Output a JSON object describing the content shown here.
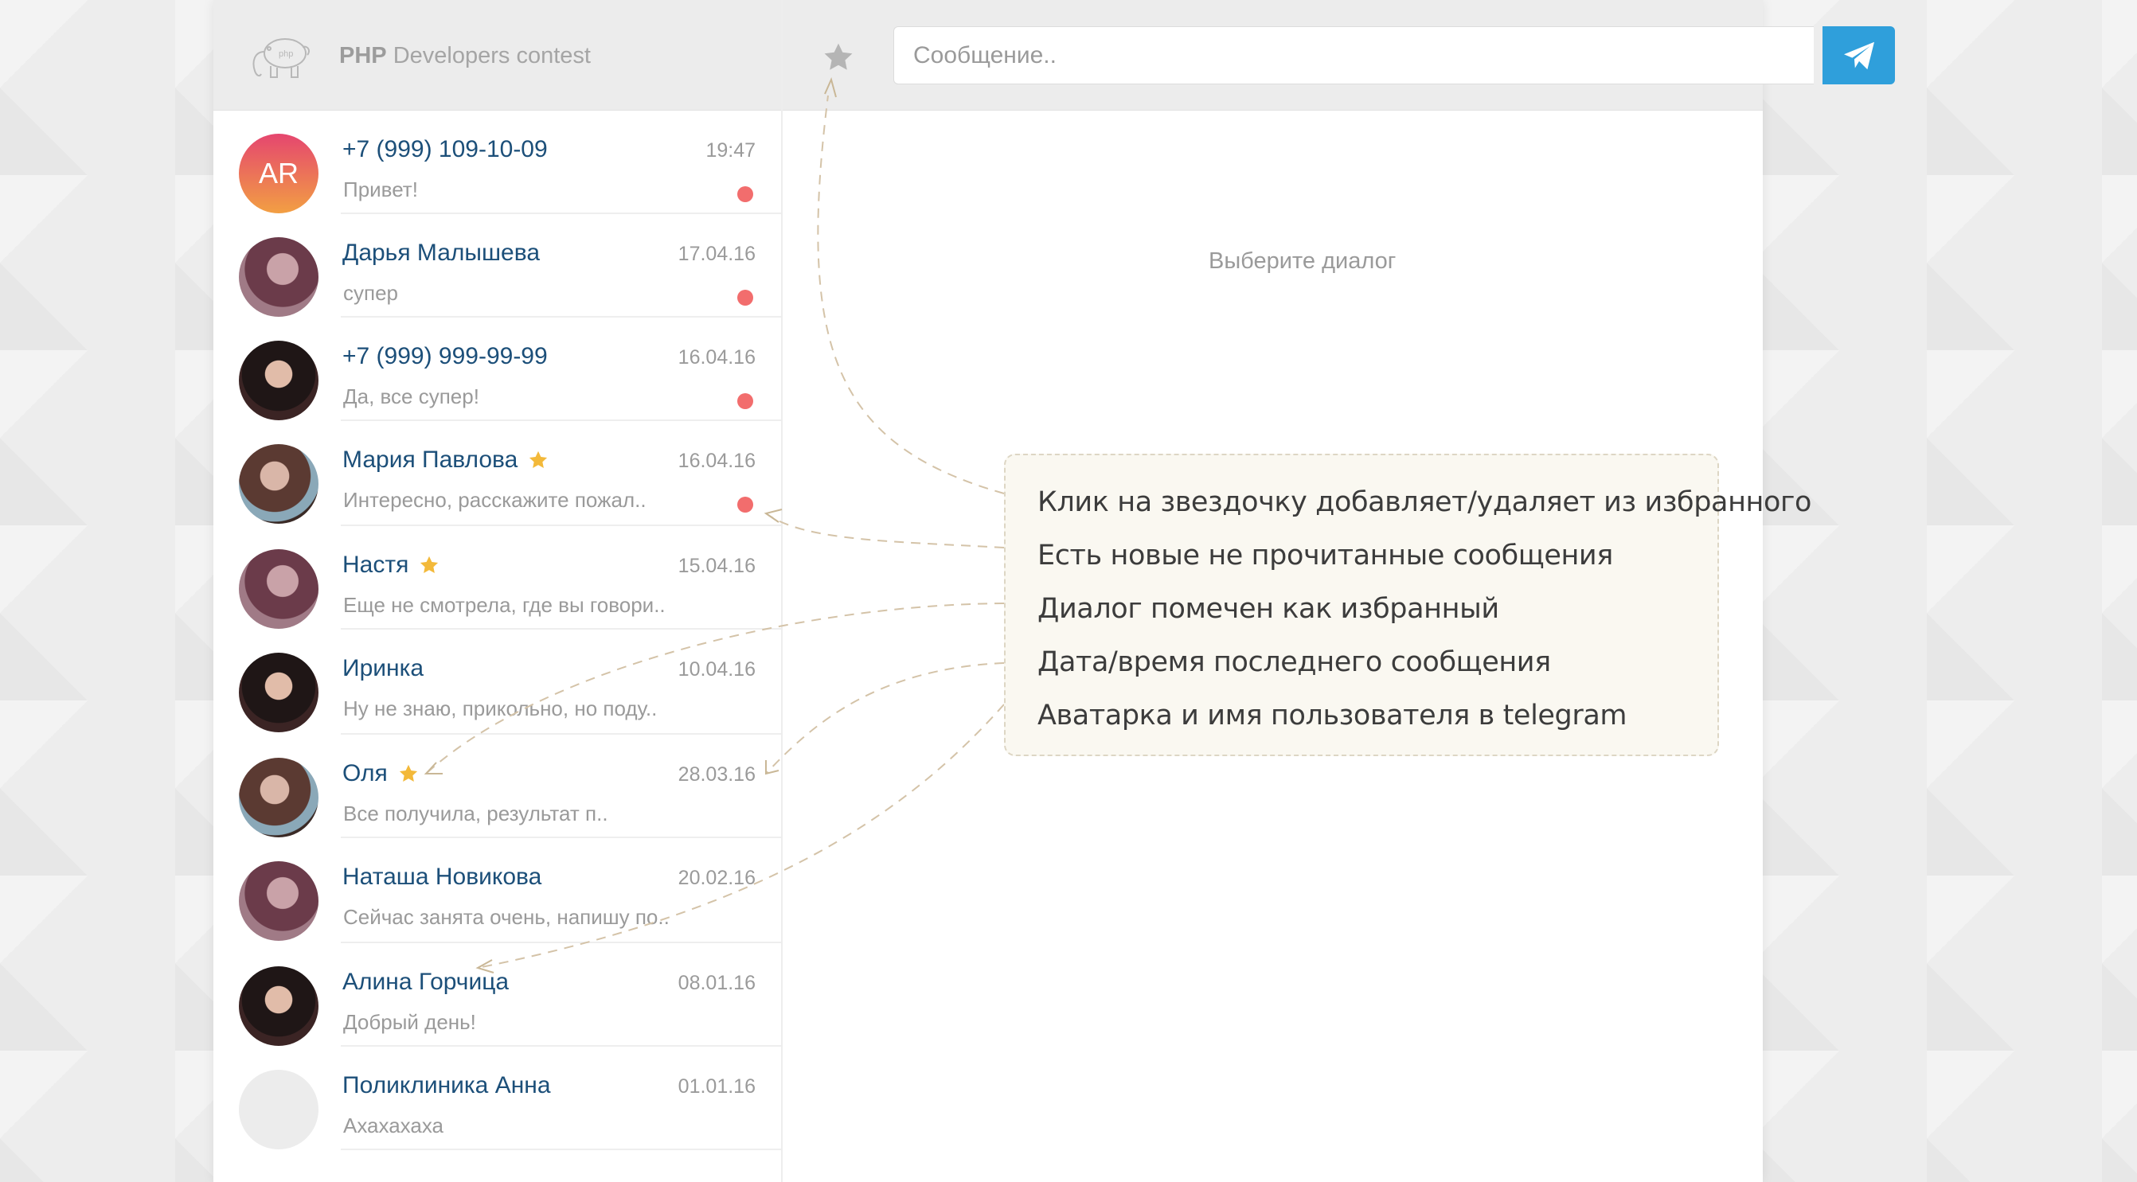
{
  "header": {
    "brand_bold": "PHP",
    "brand_rest": " Developers contest",
    "logo_icon": "elephant-icon",
    "favorite_icon": "star-icon",
    "message_placeholder": "Сообщение..",
    "send_icon": "send-icon"
  },
  "colors": {
    "accent": "#2f9fdb",
    "unread": "#f26d6d",
    "favorite": "#f3b93a",
    "name": "#1c4f79"
  },
  "dialogs": [
    {
      "name": "+7 (999) 109-10-09",
      "date": "19:47",
      "preview": "Привет!",
      "avatar": "initials",
      "initials": "AR",
      "favorite": false,
      "unread": true
    },
    {
      "name": "Дарья Малышева",
      "date": "17.04.16",
      "preview": "супер",
      "avatar": "photo",
      "favorite": false,
      "unread": true
    },
    {
      "name": "+7 (999) 999-99-99",
      "date": "16.04.16",
      "preview": "Да, все супер!",
      "avatar": "photo",
      "favorite": false,
      "unread": true
    },
    {
      "name": "Мария Павлова",
      "date": "16.04.16",
      "preview": "Интересно, расскажите пожал..",
      "avatar": "photo",
      "favorite": true,
      "unread": true
    },
    {
      "name": "Настя",
      "date": "15.04.16",
      "preview": "Еще не смотрела, где вы говори..",
      "avatar": "photo",
      "favorite": true,
      "unread": false
    },
    {
      "name": "Иринка",
      "date": "10.04.16",
      "preview": "Ну не знаю, прикольно, но поду..",
      "avatar": "photo",
      "favorite": false,
      "unread": false
    },
    {
      "name": "Оля",
      "date": "28.03.16",
      "preview": "Все получила, результат п..",
      "avatar": "photo",
      "favorite": true,
      "unread": false
    },
    {
      "name": "Наташа Новикова",
      "date": "20.02.16",
      "preview": "Сейчас занята очень, напишу по..",
      "avatar": "photo",
      "favorite": false,
      "unread": false
    },
    {
      "name": "Алина Горчица",
      "date": "08.01.16",
      "preview": "Добрый день!",
      "avatar": "photo",
      "favorite": false,
      "unread": false
    },
    {
      "name": "Поликлиника Анна",
      "date": "01.01.16",
      "preview": "Ахахахаха",
      "avatar": "empty",
      "favorite": false,
      "unread": false
    }
  ],
  "main": {
    "empty_state": "Выберите диалог"
  },
  "annotation": {
    "lines": [
      "Клик на звездочку добавляет/удаляет из избранного",
      "Есть новые не прочитанные сообщения",
      "Диалог помечен как избранный",
      "Дата/время последнего сообщения",
      "Аватарка и имя пользователя в telegram"
    ]
  }
}
